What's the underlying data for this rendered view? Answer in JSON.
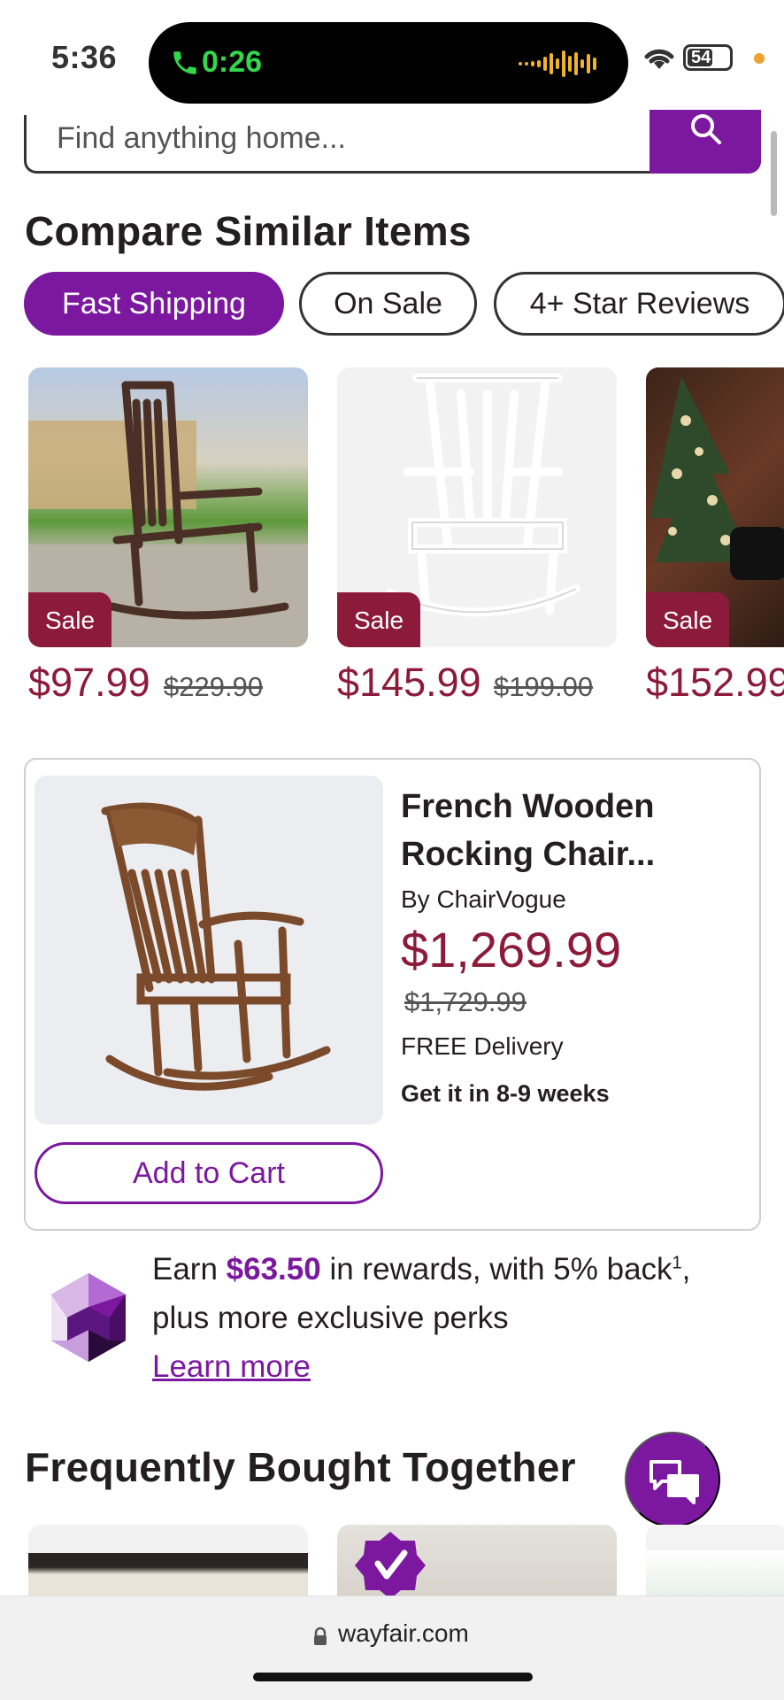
{
  "status_bar": {
    "time": "5:36",
    "call_timer": "0:26",
    "battery": "54"
  },
  "search": {
    "placeholder": "Find anything home..."
  },
  "compare": {
    "title": "Compare Similar Items",
    "filters": [
      {
        "label": "Fast Shipping",
        "active": true
      },
      {
        "label": "On Sale",
        "active": false
      },
      {
        "label": "4+ Star Reviews",
        "active": false
      }
    ],
    "products": [
      {
        "badge": "Sale",
        "price": "$97.99",
        "was_price": "$229.90"
      },
      {
        "badge": "Sale",
        "price": "$145.99",
        "was_price": "$199.00"
      },
      {
        "badge": "Sale",
        "price": "$152.99",
        "was_price": ""
      }
    ]
  },
  "featured": {
    "title": "French Wooden Rocking Chair...",
    "brand": "By ChairVogue",
    "price": "$1,269.99",
    "was_price": "$1,729.99",
    "delivery": "FREE Delivery",
    "eta": "Get it in 8-9 weeks",
    "add_to_cart": "Add to Cart"
  },
  "rewards": {
    "prefix": "Earn ",
    "amount": "$63.50",
    "suffix": " in rewards, with 5% back",
    "footnote": "1",
    "end": ",",
    "line2": "plus more exclusive perks",
    "link": "Learn more"
  },
  "fbt": {
    "title": "Frequently Bought Together"
  },
  "browser": {
    "url": "wayfair.com"
  },
  "colors": {
    "brand_purple": "#7b189f",
    "sale_red": "#8c1a3b"
  }
}
